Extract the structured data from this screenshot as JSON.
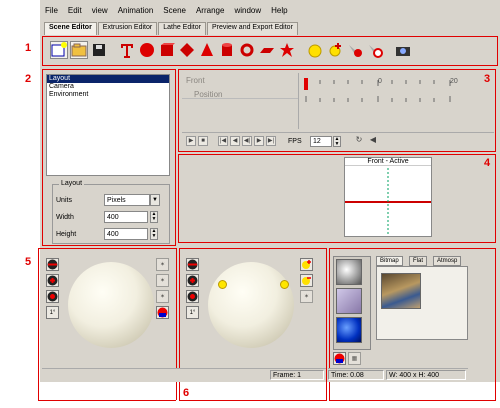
{
  "menu": [
    "File",
    "Edit",
    "view",
    "Animation",
    "Scene",
    "Arrange",
    "window",
    "Help"
  ],
  "tabs": [
    "Scene Editor",
    "Extrusion Editor",
    "Lathe Editor",
    "Preview and Export Editor"
  ],
  "markers": [
    "1",
    "2",
    "3",
    "4",
    "5",
    "6"
  ],
  "scene_list": [
    "Layout",
    "Camera",
    "Environment"
  ],
  "layout_group": {
    "title": "Layout",
    "units_label": "Units",
    "units_value": "Pixels",
    "width_label": "Width",
    "width_value": "400",
    "height_label": "Height",
    "height_value": "400"
  },
  "timeline": {
    "track_front": "Front",
    "track_position": "Position",
    "ruler_zero": "0",
    "ruler_twenty": "20",
    "fps_label": "FPS",
    "fps_value": "12"
  },
  "viewport": {
    "title": "Front - Active"
  },
  "light_panel": {
    "degree_label": "1°"
  },
  "color_panel": {
    "degree_label": "1°"
  },
  "texture_tabs": [
    "Bitmap",
    "Flat",
    "Atmosp"
  ],
  "status": {
    "frame": "Frame: 1",
    "time": "Time: 0.08",
    "dims": "W: 400 x H: 400"
  },
  "colors": {
    "annotation": "#e00000",
    "selection": "#0a246a",
    "panel": "#d8d4cc"
  }
}
